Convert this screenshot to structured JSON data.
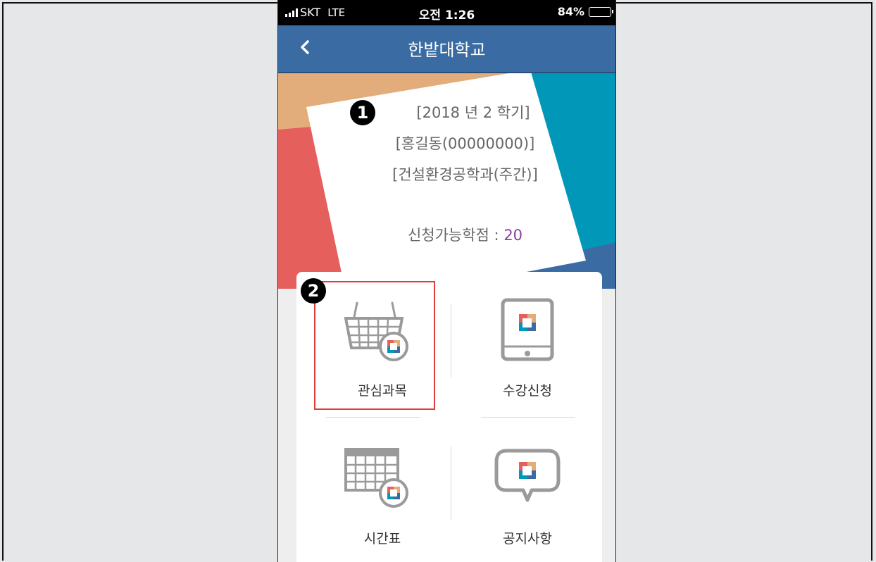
{
  "status_bar": {
    "carrier": "SKT",
    "network": "LTE",
    "time": "오전 1:26",
    "battery": "84%",
    "battery_level": 0.84
  },
  "app_bar": {
    "title": "한밭대학교",
    "back_icon": "chevron-left-icon"
  },
  "student_card": {
    "semester": "[2018 년 2 학기]",
    "student": "[홍길동(00000000)]",
    "department": "[건설환경공학과(주간)]",
    "credits_label": "신청가능학점 : ",
    "credits_value": "20",
    "marker": "1"
  },
  "menu": {
    "marker": "2",
    "items": [
      {
        "label": "관심과목",
        "icon": "shopping-basket-icon"
      },
      {
        "label": "수강신청",
        "icon": "tablet-icon"
      },
      {
        "label": "시간표",
        "icon": "calendar-grid-icon"
      },
      {
        "label": "공지사항",
        "icon": "speech-bubble-icon"
      }
    ]
  },
  "colors": {
    "app_bar": "#3a6ca3",
    "accent_red": "#e55f5d",
    "accent_orange": "#e2ad7b",
    "accent_teal": "#0097b8",
    "credits_value": "#8a3f9b",
    "highlight": "#e23b3b"
  }
}
